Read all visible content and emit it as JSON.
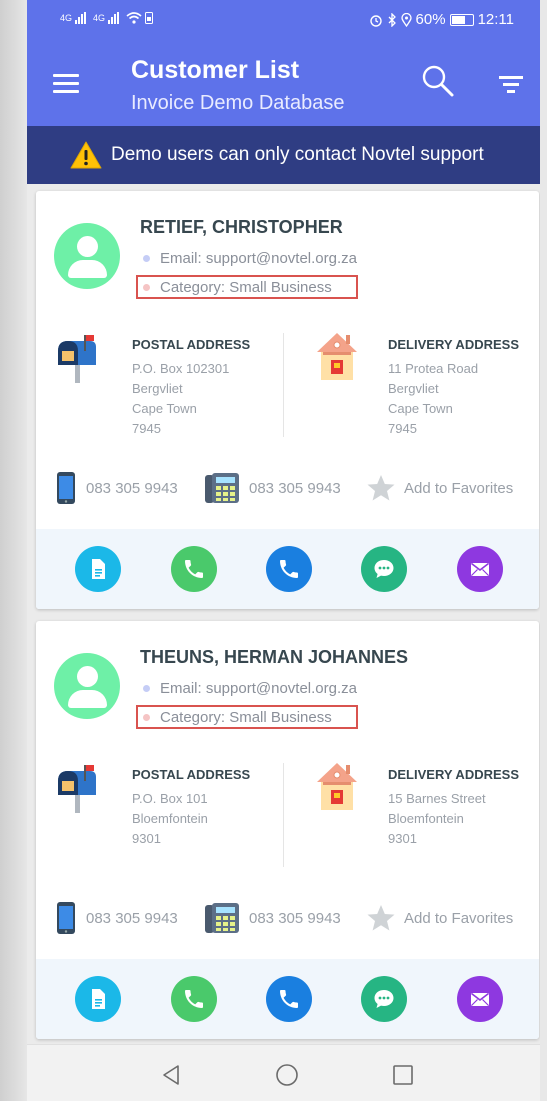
{
  "status_bar": {
    "network_1": "4G",
    "network_2": "4G",
    "battery_percent": "60%",
    "time": "12:11"
  },
  "app_bar": {
    "title": "Customer List",
    "subtitle": "Invoice Demo Database",
    "menu_icon": "menu-icon",
    "search_icon": "search-icon",
    "filter_icon": "filter-icon"
  },
  "notice": {
    "icon": "warning-icon",
    "text": "Demo users can only contact Novtel support"
  },
  "customers": [
    {
      "name": "RETIEF, CHRISTOPHER",
      "email": "Email: support@novtel.org.za",
      "category": "Category: Small Business",
      "postal_title": "POSTAL ADDRESS",
      "postal_lines": [
        "P.O. Box 102301",
        "Bergvliet",
        "Cape Town",
        "7945"
      ],
      "delivery_title": "DELIVERY ADDRESS",
      "delivery_lines": [
        "11 Protea Road",
        "Bergvliet",
        "Cape Town",
        "7945"
      ],
      "mobile": "083 305 9943",
      "phone": "083 305 9943",
      "favorite": "Add to Favorites"
    },
    {
      "name": "THEUNS, HERMAN JOHANNES",
      "email": "Email: support@novtel.org.za",
      "category": "Category: Small Business",
      "postal_title": "POSTAL ADDRESS",
      "postal_lines": [
        "P.O. Box 101",
        "Bloemfontein",
        "9301"
      ],
      "delivery_title": "DELIVERY ADDRESS",
      "delivery_lines": [
        "15 Barnes Street",
        "Bloemfontein",
        "9301"
      ],
      "mobile": "083 305 9943",
      "phone": "083 305 9943",
      "favorite": "Add to Favorites"
    }
  ],
  "actions": [
    {
      "icon": "document-icon",
      "color": "#1bb8e8"
    },
    {
      "icon": "phone-icon",
      "color": "#4ac96b"
    },
    {
      "icon": "phone-icon",
      "color": "#1a7fe0"
    },
    {
      "icon": "message-icon",
      "color": "#26b583"
    },
    {
      "icon": "mail-icon",
      "color": "#8e38e0"
    }
  ],
  "nav": {
    "back_icon": "back-icon",
    "home_icon": "home-icon",
    "recents_icon": "recents-icon"
  },
  "colors": {
    "app_bar": "#5e72ea",
    "notice": "#2f3d83",
    "avatar": "#6ef0a7",
    "highlight": "#d9534f"
  }
}
